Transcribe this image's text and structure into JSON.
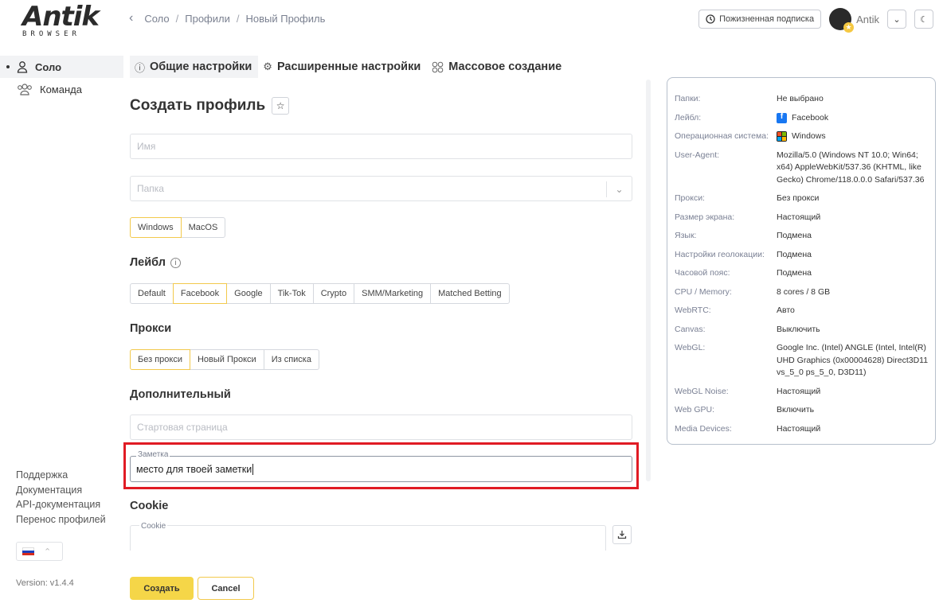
{
  "logo": {
    "main": "Antik",
    "sub": "BROWSER"
  },
  "breadcrumb": {
    "items": [
      "Соло",
      "Профили",
      "Новый Профиль"
    ],
    "sep": "/"
  },
  "header": {
    "subscription": "Пожизненная подписка",
    "user": "Antik"
  },
  "sidebar": {
    "items": [
      {
        "label": "Соло"
      },
      {
        "label": "Команда"
      }
    ],
    "links": [
      "Поддержка",
      "Документация",
      "API-документация",
      "Перенос профилей"
    ],
    "version": "Version: v1.4.4"
  },
  "tabs": [
    "Общие настройки",
    "Расширенные настройки",
    "Массовое создание"
  ],
  "form": {
    "title": "Создать профиль",
    "name_placeholder": "Имя",
    "folder_placeholder": "Папка",
    "os_options": [
      "Windows",
      "MacOS"
    ],
    "label_section": "Лейбл",
    "label_options": [
      "Default",
      "Facebook",
      "Google",
      "Tik-Tok",
      "Crypto",
      "SMM/Marketing",
      "Matched Betting"
    ],
    "proxy_section": "Прокси",
    "proxy_options": [
      "Без прокси",
      "Новый Прокси",
      "Из списка"
    ],
    "extra_section": "Дополнительный",
    "start_page_placeholder": "Стартовая страница",
    "note_label": "Заметка",
    "note_value": "место для твоей заметки",
    "cookie_section": "Cookie",
    "cookie_label": "Cookie",
    "create": "Создать",
    "cancel": "Cancel"
  },
  "summary": [
    {
      "k": "Папки:",
      "v": "Не выбрано"
    },
    {
      "k": "Лейбл:",
      "v": "Facebook"
    },
    {
      "k": "Операционная система:",
      "v": "Windows"
    },
    {
      "k": "User-Agent:",
      "v": "Mozilla/5.0 (Windows NT 10.0; Win64; x64) AppleWebKit/537.36 (KHTML, like Gecko) Chrome/118.0.0.0 Safari/537.36"
    },
    {
      "k": "Прокси:",
      "v": "Без прокси"
    },
    {
      "k": "Размер экрана:",
      "v": "Настоящий"
    },
    {
      "k": "Язык:",
      "v": "Подмена"
    },
    {
      "k": "Настройки геолокации:",
      "v": "Подмена"
    },
    {
      "k": "Часовой пояс:",
      "v": "Подмена"
    },
    {
      "k": "CPU / Memory:",
      "v": "8 cores / 8 GB"
    },
    {
      "k": "WebRTC:",
      "v": "Авто"
    },
    {
      "k": "Canvas:",
      "v": "Выключить"
    },
    {
      "k": "WebGL:",
      "v": "Google Inc. (Intel) ANGLE (Intel, Intel(R) UHD Graphics (0x00004628) Direct3D11 vs_5_0 ps_5_0, D3D11)"
    },
    {
      "k": "WebGL Noise:",
      "v": "Настоящий"
    },
    {
      "k": "Web GPU:",
      "v": "Включить"
    },
    {
      "k": "Media Devices:",
      "v": "Настоящий"
    }
  ],
  "colors": {
    "accent": "#f5d648",
    "highlight": "#e01b24",
    "facebook": "#1877f2"
  }
}
